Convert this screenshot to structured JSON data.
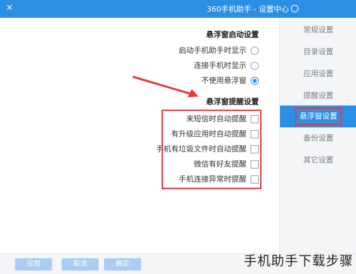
{
  "window": {
    "title": "360手机助手 - 设置中心",
    "close_icon": "×"
  },
  "sidebar": {
    "items": [
      {
        "label": "常规设置"
      },
      {
        "label": "目录设置"
      },
      {
        "label": "应用设置"
      },
      {
        "label": "提醒设置"
      },
      {
        "label": "悬浮窗设置",
        "active": true
      },
      {
        "label": "备份设置"
      },
      {
        "label": "其它设置"
      }
    ]
  },
  "main": {
    "autostart": {
      "title": "悬浮窗启动设置",
      "options": [
        {
          "label": "启动手机助手时显示",
          "checked": false
        },
        {
          "label": "连接手机时显示",
          "checked": false
        },
        {
          "label": "不使用悬浮窗",
          "checked": true
        }
      ]
    },
    "reminders": {
      "title": "悬浮窗提醒设置",
      "options": [
        {
          "label": "来短信时自动提醒",
          "checked": false
        },
        {
          "label": "有升级应用时自动提醒",
          "checked": false
        },
        {
          "label": "手机有垃圾文件时自动提醒",
          "checked": false
        },
        {
          "label": "微信有好友提醒",
          "checked": false
        },
        {
          "label": "手机连接异常时提醒",
          "checked": false
        }
      ]
    }
  },
  "footer": {
    "ok_label": "确定",
    "cancel_label": "取消",
    "apply_label": "应用"
  },
  "watermark": "手机助手下载步骤",
  "colors": {
    "accent": "#2b8fe3",
    "highlight": "#e53b3b"
  }
}
